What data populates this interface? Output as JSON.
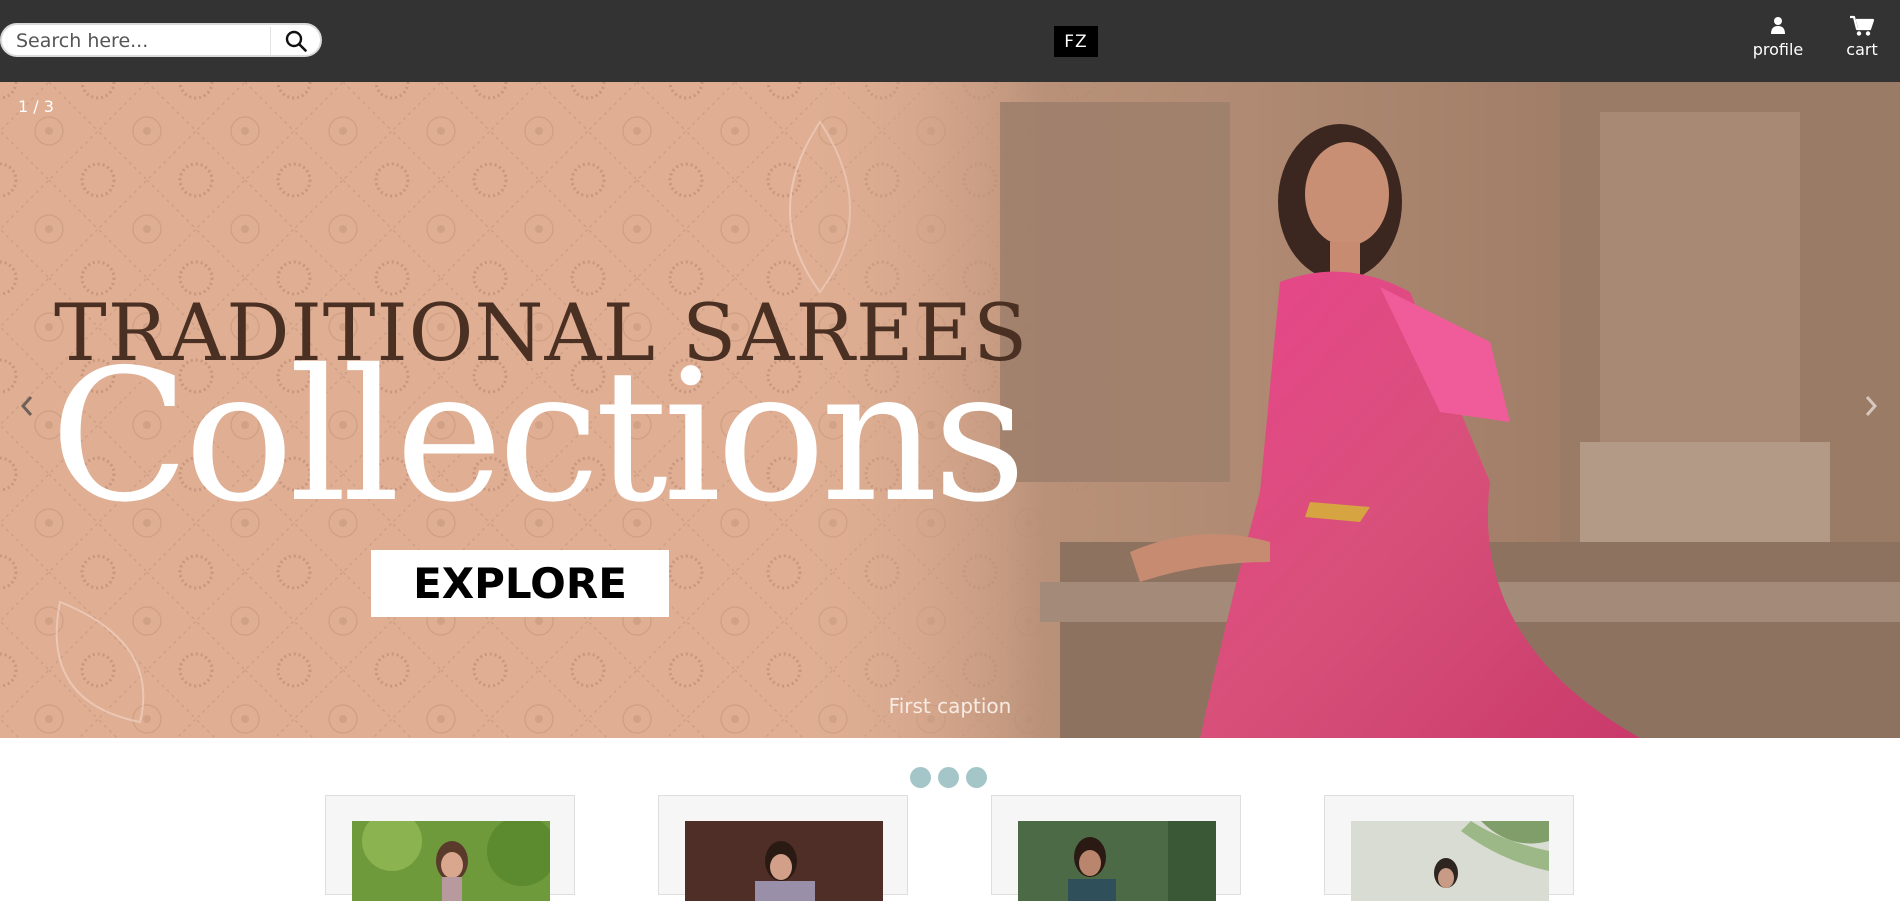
{
  "header": {
    "search": {
      "placeholder": "Search here..."
    },
    "logo": "FZ",
    "profile_label": "profile",
    "cart_label": "cart",
    "icon_names": [
      "search-icon",
      "user-icon",
      "cart-icon"
    ],
    "background_color": "#333333"
  },
  "carousel": {
    "counter": "1 / 3",
    "headline": "TRADITIONAL SAREES",
    "script_text": "Collections",
    "button_label": "EXPLORE",
    "caption": "First caption",
    "prev_icon": "chevron-left-icon",
    "next_icon": "chevron-right-icon",
    "slide_count": 3,
    "active_slide": 1,
    "dot_color": "#a4c6c8"
  },
  "products": [
    {
      "image": "saree-green-garden-photo"
    },
    {
      "image": "saree-brown-studio-photo"
    },
    {
      "image": "saree-teal-photo"
    },
    {
      "image": "saree-light-outdoor-photo"
    }
  ]
}
